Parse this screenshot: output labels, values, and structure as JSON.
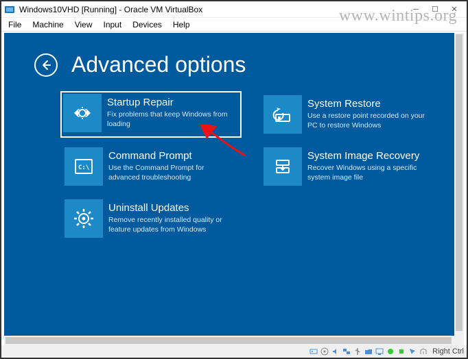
{
  "window": {
    "title": "Windows10VHD [Running] - Oracle VM VirtualBox",
    "menu": [
      "File",
      "Machine",
      "View",
      "Input",
      "Devices",
      "Help"
    ]
  },
  "watermark": "www.wintips.org",
  "recovery": {
    "title": "Advanced options",
    "tiles": [
      {
        "title": "Startup Repair",
        "desc": "Fix problems that keep Windows from loading",
        "icon": "startup-repair-icon"
      },
      {
        "title": "System Restore",
        "desc": "Use a restore point recorded on your PC to restore Windows",
        "icon": "system-restore-icon"
      },
      {
        "title": "Command Prompt",
        "desc": "Use the Command Prompt for advanced troubleshooting",
        "icon": "command-prompt-icon"
      },
      {
        "title": "System Image Recovery",
        "desc": "Recover Windows using a specific system image file",
        "icon": "system-image-recovery-icon"
      },
      {
        "title": "Uninstall Updates",
        "desc": "Remove recently installed quality or feature updates from Windows",
        "icon": "uninstall-updates-icon"
      }
    ]
  },
  "statusbar": {
    "hostkey": "Right Ctrl"
  }
}
